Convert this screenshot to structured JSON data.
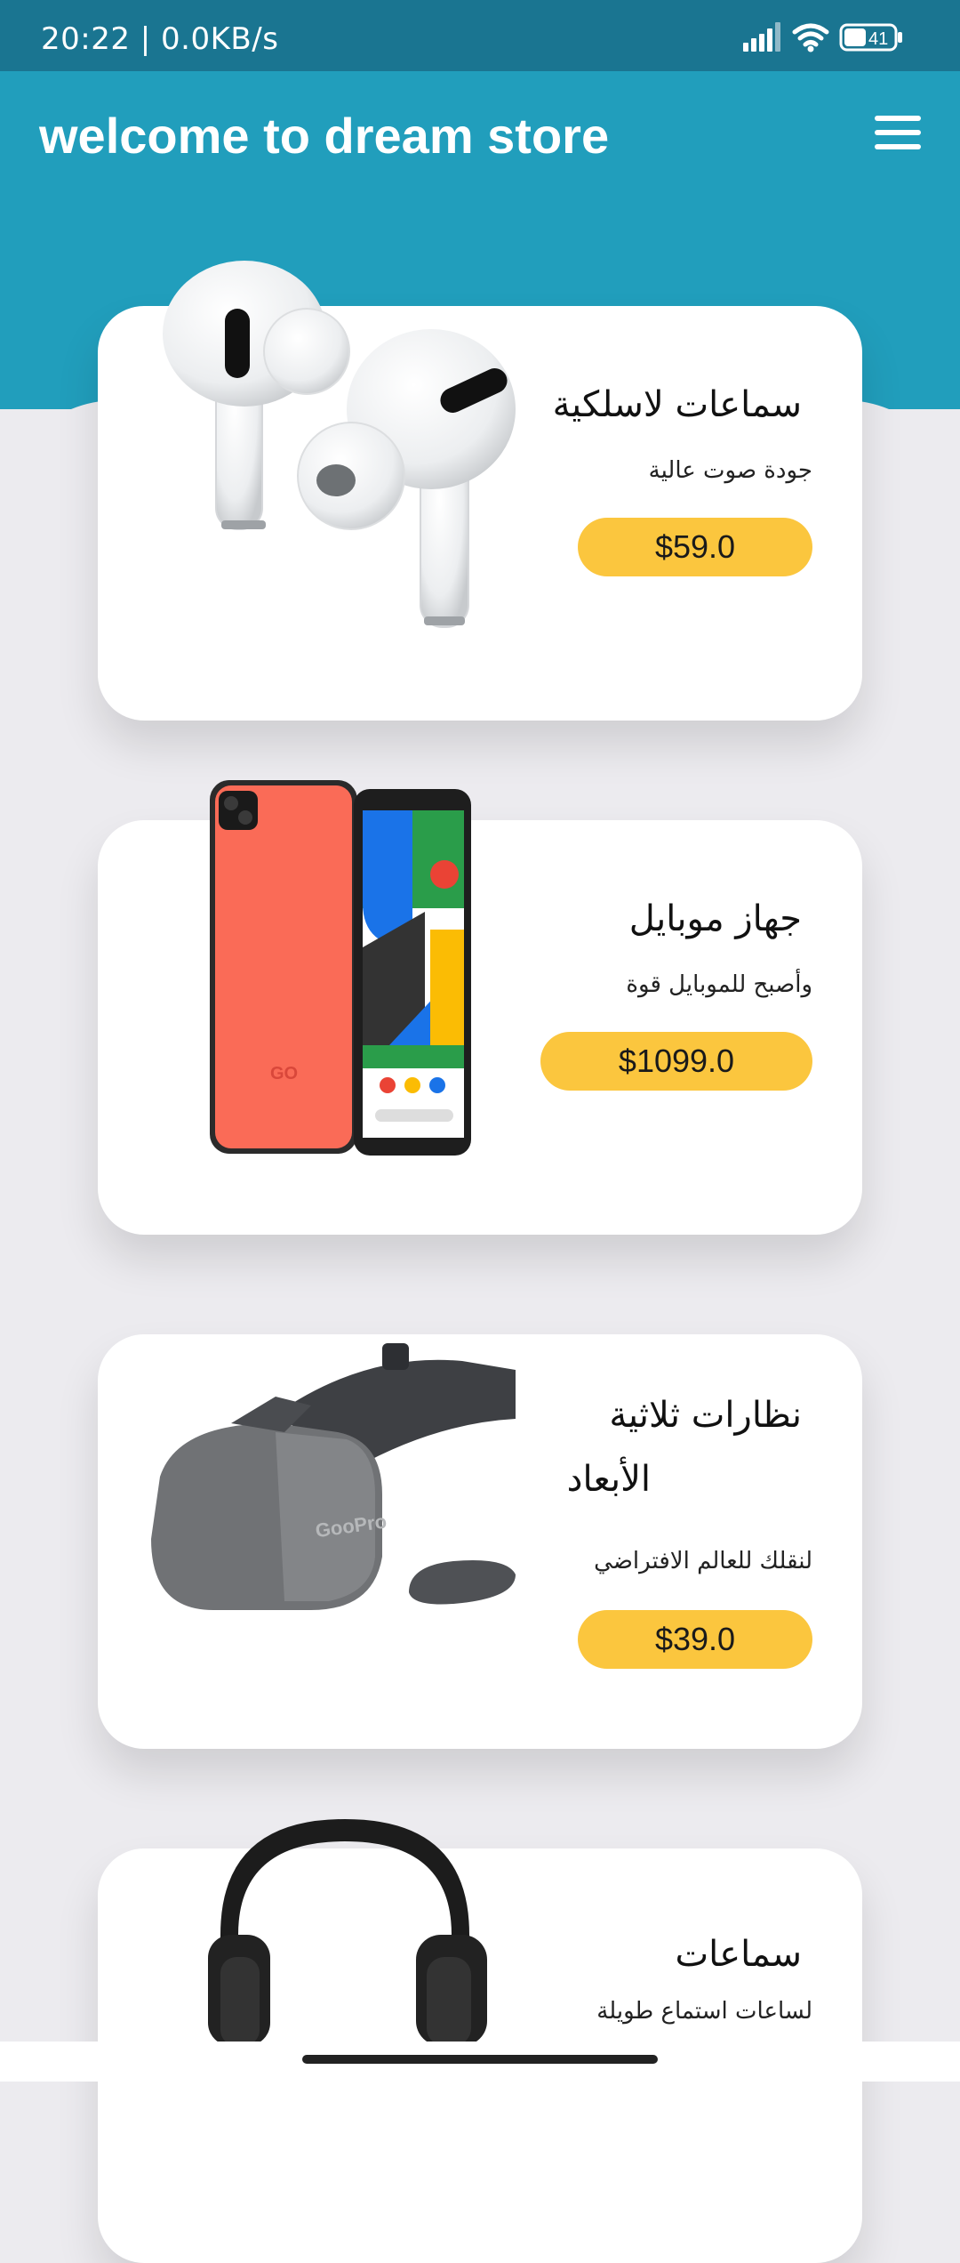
{
  "status_bar": {
    "time": "20:22 | 0.0KB/s",
    "battery": "41"
  },
  "header": {
    "title": "welcome to dream store",
    "menu_icon": "hamburger-menu-icon"
  },
  "products": [
    {
      "title": "سماعات لاسلكية",
      "subtitle": "جودة صوت عالية",
      "price": "$59.0",
      "image": "wireless-earbuds"
    },
    {
      "title": "جهاز موبايل",
      "subtitle": "وأصبح للموبايل قوة",
      "price": "$1099.0",
      "image": "smartphone",
      "phone_logo": "GO"
    },
    {
      "title_line1": "نظارات ثلاثية",
      "title_line2": "الأبعاد",
      "subtitle": "لنقلك للعالم الافتراضي",
      "price": "$39.0",
      "image": "vr-headset",
      "brand": "GooPro"
    },
    {
      "title": "سماعات",
      "subtitle": "لساعات استماع طويلة",
      "image": "over-ear-headphones"
    }
  ],
  "colors": {
    "status_bar": "#1a7591",
    "header": "#219ebc",
    "background": "#ecebef",
    "price_button": "#fbc63e"
  }
}
